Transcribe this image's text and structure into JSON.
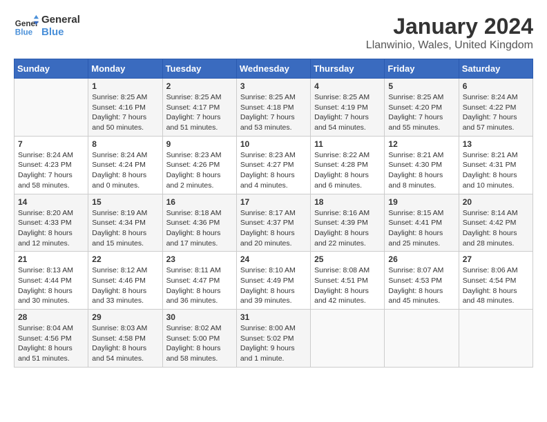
{
  "logo": {
    "line1": "General",
    "line2": "Blue"
  },
  "title": "January 2024",
  "subtitle": "Llanwinio, Wales, United Kingdom",
  "days_of_week": [
    "Sunday",
    "Monday",
    "Tuesday",
    "Wednesday",
    "Thursday",
    "Friday",
    "Saturday"
  ],
  "weeks": [
    [
      {
        "day": "",
        "sunrise": "",
        "sunset": "",
        "daylight": ""
      },
      {
        "day": "1",
        "sunrise": "Sunrise: 8:25 AM",
        "sunset": "Sunset: 4:16 PM",
        "daylight": "Daylight: 7 hours and 50 minutes."
      },
      {
        "day": "2",
        "sunrise": "Sunrise: 8:25 AM",
        "sunset": "Sunset: 4:17 PM",
        "daylight": "Daylight: 7 hours and 51 minutes."
      },
      {
        "day": "3",
        "sunrise": "Sunrise: 8:25 AM",
        "sunset": "Sunset: 4:18 PM",
        "daylight": "Daylight: 7 hours and 53 minutes."
      },
      {
        "day": "4",
        "sunrise": "Sunrise: 8:25 AM",
        "sunset": "Sunset: 4:19 PM",
        "daylight": "Daylight: 7 hours and 54 minutes."
      },
      {
        "day": "5",
        "sunrise": "Sunrise: 8:25 AM",
        "sunset": "Sunset: 4:20 PM",
        "daylight": "Daylight: 7 hours and 55 minutes."
      },
      {
        "day": "6",
        "sunrise": "Sunrise: 8:24 AM",
        "sunset": "Sunset: 4:22 PM",
        "daylight": "Daylight: 7 hours and 57 minutes."
      }
    ],
    [
      {
        "day": "7",
        "sunrise": "Sunrise: 8:24 AM",
        "sunset": "Sunset: 4:23 PM",
        "daylight": "Daylight: 7 hours and 58 minutes."
      },
      {
        "day": "8",
        "sunrise": "Sunrise: 8:24 AM",
        "sunset": "Sunset: 4:24 PM",
        "daylight": "Daylight: 8 hours and 0 minutes."
      },
      {
        "day": "9",
        "sunrise": "Sunrise: 8:23 AM",
        "sunset": "Sunset: 4:26 PM",
        "daylight": "Daylight: 8 hours and 2 minutes."
      },
      {
        "day": "10",
        "sunrise": "Sunrise: 8:23 AM",
        "sunset": "Sunset: 4:27 PM",
        "daylight": "Daylight: 8 hours and 4 minutes."
      },
      {
        "day": "11",
        "sunrise": "Sunrise: 8:22 AM",
        "sunset": "Sunset: 4:28 PM",
        "daylight": "Daylight: 8 hours and 6 minutes."
      },
      {
        "day": "12",
        "sunrise": "Sunrise: 8:21 AM",
        "sunset": "Sunset: 4:30 PM",
        "daylight": "Daylight: 8 hours and 8 minutes."
      },
      {
        "day": "13",
        "sunrise": "Sunrise: 8:21 AM",
        "sunset": "Sunset: 4:31 PM",
        "daylight": "Daylight: 8 hours and 10 minutes."
      }
    ],
    [
      {
        "day": "14",
        "sunrise": "Sunrise: 8:20 AM",
        "sunset": "Sunset: 4:33 PM",
        "daylight": "Daylight: 8 hours and 12 minutes."
      },
      {
        "day": "15",
        "sunrise": "Sunrise: 8:19 AM",
        "sunset": "Sunset: 4:34 PM",
        "daylight": "Daylight: 8 hours and 15 minutes."
      },
      {
        "day": "16",
        "sunrise": "Sunrise: 8:18 AM",
        "sunset": "Sunset: 4:36 PM",
        "daylight": "Daylight: 8 hours and 17 minutes."
      },
      {
        "day": "17",
        "sunrise": "Sunrise: 8:17 AM",
        "sunset": "Sunset: 4:37 PM",
        "daylight": "Daylight: 8 hours and 20 minutes."
      },
      {
        "day": "18",
        "sunrise": "Sunrise: 8:16 AM",
        "sunset": "Sunset: 4:39 PM",
        "daylight": "Daylight: 8 hours and 22 minutes."
      },
      {
        "day": "19",
        "sunrise": "Sunrise: 8:15 AM",
        "sunset": "Sunset: 4:41 PM",
        "daylight": "Daylight: 8 hours and 25 minutes."
      },
      {
        "day": "20",
        "sunrise": "Sunrise: 8:14 AM",
        "sunset": "Sunset: 4:42 PM",
        "daylight": "Daylight: 8 hours and 28 minutes."
      }
    ],
    [
      {
        "day": "21",
        "sunrise": "Sunrise: 8:13 AM",
        "sunset": "Sunset: 4:44 PM",
        "daylight": "Daylight: 8 hours and 30 minutes."
      },
      {
        "day": "22",
        "sunrise": "Sunrise: 8:12 AM",
        "sunset": "Sunset: 4:46 PM",
        "daylight": "Daylight: 8 hours and 33 minutes."
      },
      {
        "day": "23",
        "sunrise": "Sunrise: 8:11 AM",
        "sunset": "Sunset: 4:47 PM",
        "daylight": "Daylight: 8 hours and 36 minutes."
      },
      {
        "day": "24",
        "sunrise": "Sunrise: 8:10 AM",
        "sunset": "Sunset: 4:49 PM",
        "daylight": "Daylight: 8 hours and 39 minutes."
      },
      {
        "day": "25",
        "sunrise": "Sunrise: 8:08 AM",
        "sunset": "Sunset: 4:51 PM",
        "daylight": "Daylight: 8 hours and 42 minutes."
      },
      {
        "day": "26",
        "sunrise": "Sunrise: 8:07 AM",
        "sunset": "Sunset: 4:53 PM",
        "daylight": "Daylight: 8 hours and 45 minutes."
      },
      {
        "day": "27",
        "sunrise": "Sunrise: 8:06 AM",
        "sunset": "Sunset: 4:54 PM",
        "daylight": "Daylight: 8 hours and 48 minutes."
      }
    ],
    [
      {
        "day": "28",
        "sunrise": "Sunrise: 8:04 AM",
        "sunset": "Sunset: 4:56 PM",
        "daylight": "Daylight: 8 hours and 51 minutes."
      },
      {
        "day": "29",
        "sunrise": "Sunrise: 8:03 AM",
        "sunset": "Sunset: 4:58 PM",
        "daylight": "Daylight: 8 hours and 54 minutes."
      },
      {
        "day": "30",
        "sunrise": "Sunrise: 8:02 AM",
        "sunset": "Sunset: 5:00 PM",
        "daylight": "Daylight: 8 hours and 58 minutes."
      },
      {
        "day": "31",
        "sunrise": "Sunrise: 8:00 AM",
        "sunset": "Sunset: 5:02 PM",
        "daylight": "Daylight: 9 hours and 1 minute."
      },
      {
        "day": "",
        "sunrise": "",
        "sunset": "",
        "daylight": ""
      },
      {
        "day": "",
        "sunrise": "",
        "sunset": "",
        "daylight": ""
      },
      {
        "day": "",
        "sunrise": "",
        "sunset": "",
        "daylight": ""
      }
    ]
  ]
}
